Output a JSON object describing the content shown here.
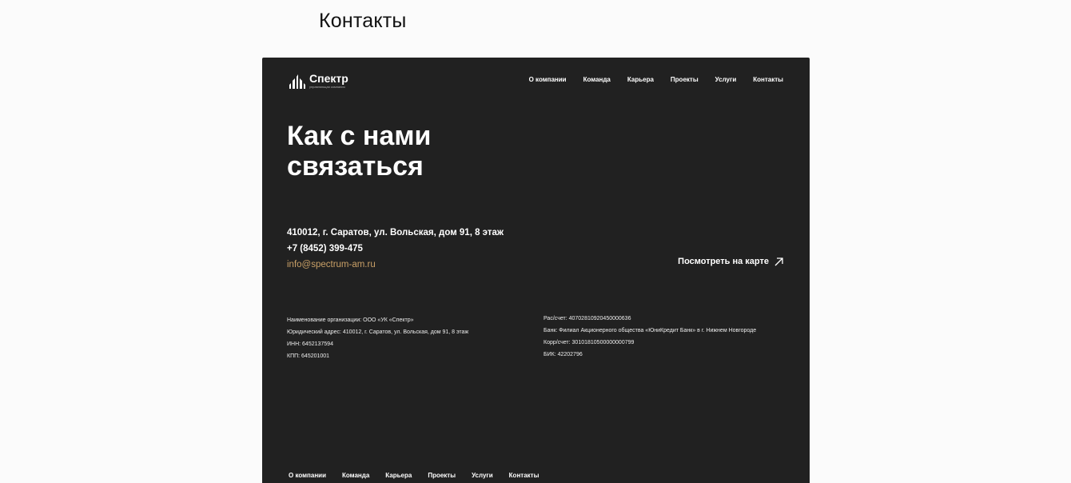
{
  "page": {
    "title": "Контакты"
  },
  "logo": {
    "name": "Спектр",
    "subtitle": "управляющая компания"
  },
  "nav": [
    {
      "label": "О компании"
    },
    {
      "label": "Команда"
    },
    {
      "label": "Карьера"
    },
    {
      "label": "Проекты"
    },
    {
      "label": "Услуги"
    },
    {
      "label": "Контакты"
    }
  ],
  "hero": {
    "line1": "Как с нами",
    "line2": "связаться"
  },
  "contacts": {
    "address": "410012, г. Саратов, ул. Вольская, дом 91, 8 этаж",
    "phone": "+7 (8452) 399-475",
    "email": "info@spectrum-am.ru",
    "map_label": "Посмотреть на карте"
  },
  "requisites": {
    "left": [
      "Наименование организации: ООО «УК «Спектр»",
      "Юридический адрес: 410012, г. Саратов, ул. Вольская, дом 91, 8 этаж",
      "ИНН: 6452137594",
      "КПП: 645201001"
    ],
    "right": [
      "Рас/счет: 40702810920450000636",
      "Банк: Филиал Акционерного общества «ЮниКредит Банк» в г. Нижнем Новгороде",
      "Корр/счет: 30101810500000000799",
      "БИК: 42202796"
    ]
  },
  "footer_nav": [
    {
      "label": "О компании"
    },
    {
      "label": "Команда"
    },
    {
      "label": "Карьера"
    },
    {
      "label": "Проекты"
    },
    {
      "label": "Услуги"
    },
    {
      "label": "Контакты"
    }
  ]
}
